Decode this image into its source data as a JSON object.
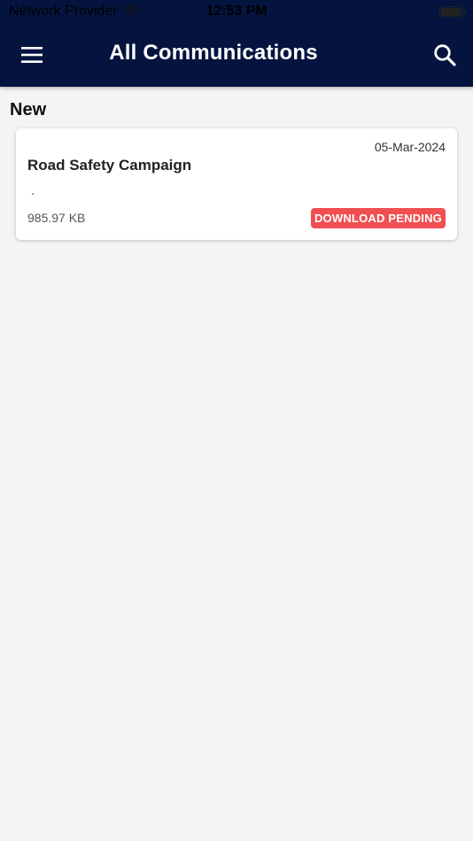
{
  "status_bar": {
    "carrier": "Network Provider",
    "time": "12:53 PM"
  },
  "header": {
    "title": "All Communications",
    "menu_icon": "hamburger-menu-icon",
    "search_icon": "search-icon",
    "background": "#05143f"
  },
  "section": {
    "heading": "New"
  },
  "communications": [
    {
      "date": "05-Mar-2024",
      "title": "Road Safety Campaign",
      "description": ".",
      "size": "985.97 KB",
      "status": "DOWNLOAD PENDING",
      "status_color": "#f04e51"
    }
  ]
}
